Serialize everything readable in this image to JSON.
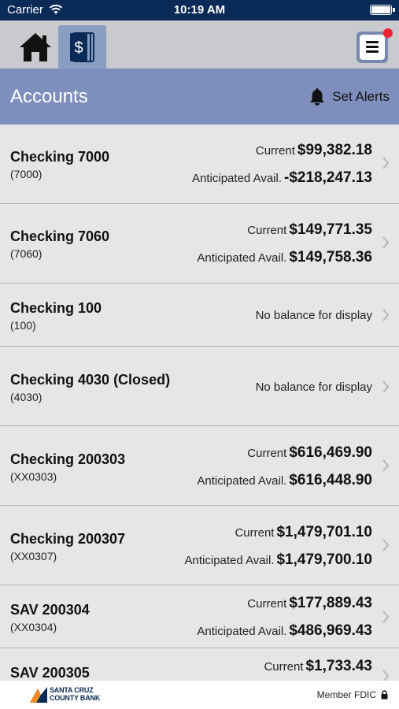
{
  "status_bar": {
    "carrier": "Carrier",
    "time": "10:19 AM"
  },
  "nav": {
    "home_icon": "home-icon",
    "accounts_icon": "dollar-document-icon",
    "menu_icon": "hamburger-menu-icon"
  },
  "header": {
    "title": "Accounts",
    "alerts_label": "Set Alerts",
    "alerts_icon": "bell-icon"
  },
  "accounts": [
    {
      "name": "Checking 7000",
      "number": "(7000)",
      "current_label": "Current",
      "current": "$99,382.18",
      "anticipated_label": "Anticipated Avail.",
      "anticipated": "-$218,247.13"
    },
    {
      "name": "Checking 7060",
      "number": "(7060)",
      "current_label": "Current",
      "current": "$149,771.35",
      "anticipated_label": "Anticipated Avail.",
      "anticipated": "$149,758.36"
    },
    {
      "name": "Checking 100",
      "number": "(100)",
      "no_balance": "No balance for display"
    },
    {
      "name": "Checking 4030 (Closed)",
      "number": "(4030)",
      "no_balance": "No balance for display"
    },
    {
      "name": "Checking 200303",
      "number": "(XX0303)",
      "current_label": "Current",
      "current": "$616,469.90",
      "anticipated_label": "Anticipated Avail.",
      "anticipated": "$616,448.90"
    },
    {
      "name": "Checking 200307",
      "number": "(XX0307)",
      "current_label": "Current",
      "current": "$1,479,701.10",
      "anticipated_label": "Anticipated Avail.",
      "anticipated": "$1,479,700.10"
    },
    {
      "name": "SAV 200304",
      "number": "(XX0304)",
      "current_label": "Current",
      "current": "$177,889.43",
      "anticipated_label": "Anticipated Avail.",
      "anticipated": "$486,969.43"
    },
    {
      "name": "SAV 200305",
      "current_label": "Current",
      "current": "$1,733.43"
    }
  ],
  "footer": {
    "logo_line1": "SANTA CRUZ",
    "logo_line2": "COUNTY BANK",
    "fdic": "Member FDIC",
    "lock_icon": "lock-icon"
  },
  "colors": {
    "status_bar": "#0a2a57",
    "title_bar": "#7f8fbd",
    "active_tab": "#8a9ec4",
    "notification_dot": "#e8222e"
  }
}
